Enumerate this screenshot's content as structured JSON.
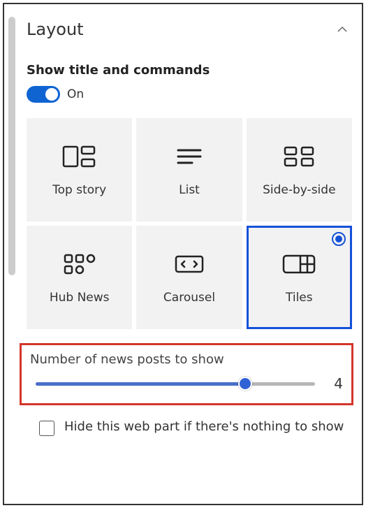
{
  "section": {
    "title": "Layout"
  },
  "toggle": {
    "heading": "Show title and commands",
    "value_label": "On"
  },
  "layouts": {
    "top_story": "Top story",
    "list": "List",
    "side_by_side": "Side-by-side",
    "hub_news": "Hub News",
    "carousel": "Carousel",
    "tiles": "Tiles"
  },
  "slider": {
    "label": "Number of news posts to show",
    "value": "4"
  },
  "checkbox": {
    "label": "Hide this web part if there's nothing to show"
  }
}
